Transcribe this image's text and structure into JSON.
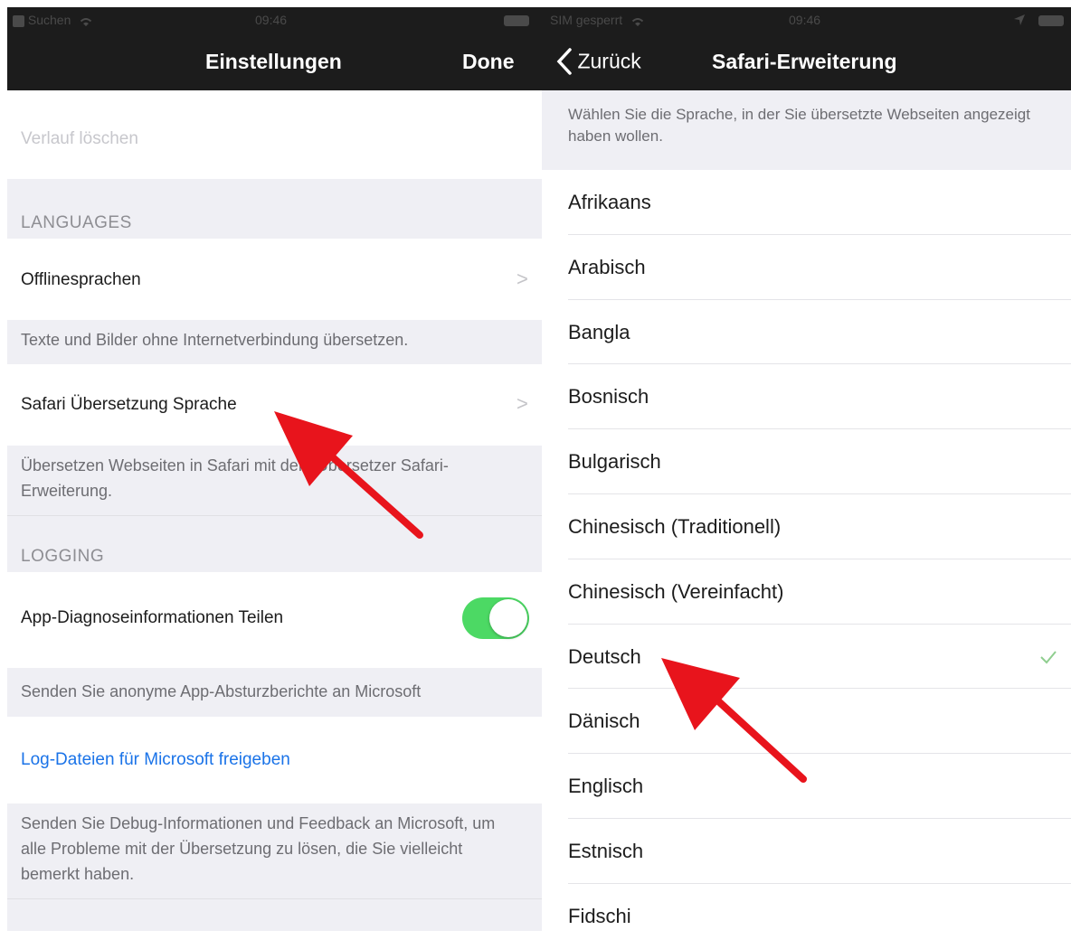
{
  "left_panel": {
    "status_bar": {
      "carrier": "Suchen",
      "time": "09:46"
    },
    "nav": {
      "title": "Einstellungen",
      "done_label": "Done"
    },
    "clear_history_label": "Verlauf löschen",
    "languages_header": "LANGUAGES",
    "offline_label": "Offlinesprachen",
    "offline_footer": "Texte und Bilder ohne Internetverbindung übersetzen.",
    "safari_label": "Safari Übersetzung Sprache",
    "safari_footer": "Übersetzen Webseiten in Safari mit dem Übersetzer Safari-Erweiterung.",
    "logging_header": "LOGGING",
    "diagnostics_label": "App-Diagnoseinformationen Teilen",
    "diagnostics_on": true,
    "diagnostics_footer": "Senden Sie anonyme App-Absturzberichte an Microsoft",
    "share_logs_label": "Log-Dateien für Microsoft freigeben",
    "share_logs_footer": "Senden Sie Debug-Informationen und Feedback an Microsoft, um alle Probleme mit der Übersetzung zu lösen, die Sie vielleicht bemerkt haben."
  },
  "right_panel": {
    "status_bar": {
      "carrier": "SIM gesperrt",
      "time": "09:46"
    },
    "nav": {
      "back_label": "Zurück",
      "title": "Safari-Erweiterung"
    },
    "description": "Wählen Sie die Sprache, in der Sie übersetzte Webseiten angezeigt haben wollen.",
    "languages": [
      "Afrikaans",
      "Arabisch",
      "Bangla",
      "Bosnisch",
      "Bulgarisch",
      "Chinesisch (Traditionell)",
      "Chinesisch (Vereinfacht)",
      "Deutsch",
      "Dänisch",
      "Englisch",
      "Estnisch",
      "Fidschi"
    ],
    "selected_language": "Deutsch"
  },
  "colors": {
    "bar_background": "#1c1c1c",
    "group_background": "#efeff4",
    "toggle_on": "#4cd964",
    "link_blue": "#1a73e8",
    "checkmark": "#8fce8f",
    "annotation_arrow": "#e8141c"
  },
  "icons": [
    "wifi-icon",
    "battery-icon",
    "location-icon",
    "chevron-right-icon",
    "back-chevron-icon",
    "checkmark-icon",
    "annotation-arrow-icon"
  ]
}
